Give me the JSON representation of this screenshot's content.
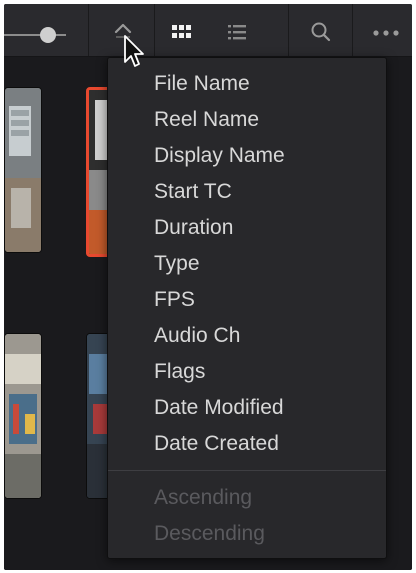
{
  "toolbar": {
    "icons": {
      "zoom_slider": "slider",
      "sort": "sort-chevron-icon",
      "thumbnail_view": "grid-icon",
      "list_view": "list-icon",
      "search": "search-icon",
      "more": "ellipsis-icon"
    }
  },
  "sort_menu": {
    "fields": [
      {
        "label": "File Name"
      },
      {
        "label": "Reel Name"
      },
      {
        "label": "Display Name"
      },
      {
        "label": "Start TC"
      },
      {
        "label": "Duration"
      },
      {
        "label": "Type"
      },
      {
        "label": "FPS"
      },
      {
        "label": "Audio Ch"
      },
      {
        "label": "Flags"
      },
      {
        "label": "Date Modified"
      },
      {
        "label": "Date Created"
      }
    ],
    "order": [
      {
        "label": "Ascending",
        "enabled": false
      },
      {
        "label": "Descending",
        "enabled": false
      }
    ]
  },
  "colors": {
    "selection_border": "#e8492f",
    "menu_text": "#d8d8d8",
    "menu_text_disabled": "#5a5a5e"
  }
}
